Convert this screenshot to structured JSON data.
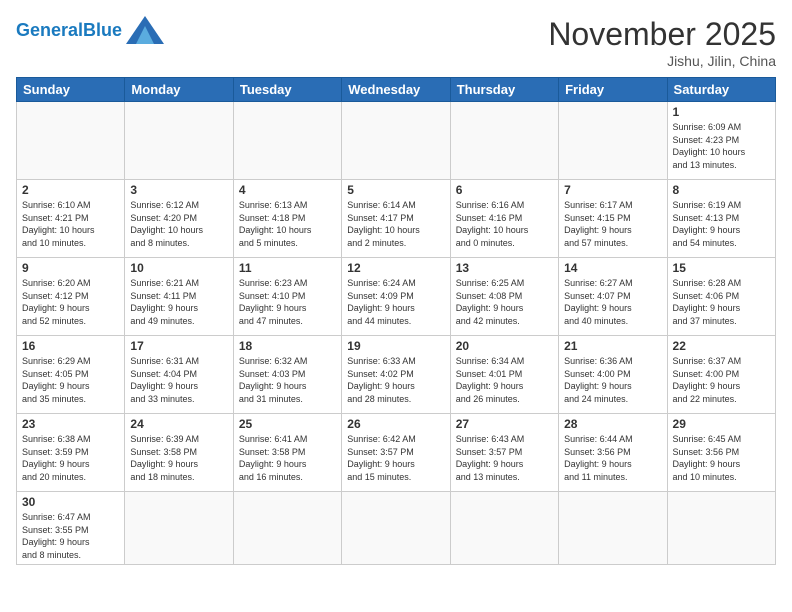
{
  "header": {
    "logo_general": "General",
    "logo_blue": "Blue",
    "month_title": "November 2025",
    "location": "Jishu, Jilin, China"
  },
  "weekdays": [
    "Sunday",
    "Monday",
    "Tuesday",
    "Wednesday",
    "Thursday",
    "Friday",
    "Saturday"
  ],
  "days": [
    {
      "num": "",
      "info": ""
    },
    {
      "num": "",
      "info": ""
    },
    {
      "num": "",
      "info": ""
    },
    {
      "num": "",
      "info": ""
    },
    {
      "num": "",
      "info": ""
    },
    {
      "num": "",
      "info": ""
    },
    {
      "num": "1",
      "info": "Sunrise: 6:09 AM\nSunset: 4:23 PM\nDaylight: 10 hours\nand 13 minutes."
    },
    {
      "num": "2",
      "info": "Sunrise: 6:10 AM\nSunset: 4:21 PM\nDaylight: 10 hours\nand 10 minutes."
    },
    {
      "num": "3",
      "info": "Sunrise: 6:12 AM\nSunset: 4:20 PM\nDaylight: 10 hours\nand 8 minutes."
    },
    {
      "num": "4",
      "info": "Sunrise: 6:13 AM\nSunset: 4:18 PM\nDaylight: 10 hours\nand 5 minutes."
    },
    {
      "num": "5",
      "info": "Sunrise: 6:14 AM\nSunset: 4:17 PM\nDaylight: 10 hours\nand 2 minutes."
    },
    {
      "num": "6",
      "info": "Sunrise: 6:16 AM\nSunset: 4:16 PM\nDaylight: 10 hours\nand 0 minutes."
    },
    {
      "num": "7",
      "info": "Sunrise: 6:17 AM\nSunset: 4:15 PM\nDaylight: 9 hours\nand 57 minutes."
    },
    {
      "num": "8",
      "info": "Sunrise: 6:19 AM\nSunset: 4:13 PM\nDaylight: 9 hours\nand 54 minutes."
    },
    {
      "num": "9",
      "info": "Sunrise: 6:20 AM\nSunset: 4:12 PM\nDaylight: 9 hours\nand 52 minutes."
    },
    {
      "num": "10",
      "info": "Sunrise: 6:21 AM\nSunset: 4:11 PM\nDaylight: 9 hours\nand 49 minutes."
    },
    {
      "num": "11",
      "info": "Sunrise: 6:23 AM\nSunset: 4:10 PM\nDaylight: 9 hours\nand 47 minutes."
    },
    {
      "num": "12",
      "info": "Sunrise: 6:24 AM\nSunset: 4:09 PM\nDaylight: 9 hours\nand 44 minutes."
    },
    {
      "num": "13",
      "info": "Sunrise: 6:25 AM\nSunset: 4:08 PM\nDaylight: 9 hours\nand 42 minutes."
    },
    {
      "num": "14",
      "info": "Sunrise: 6:27 AM\nSunset: 4:07 PM\nDaylight: 9 hours\nand 40 minutes."
    },
    {
      "num": "15",
      "info": "Sunrise: 6:28 AM\nSunset: 4:06 PM\nDaylight: 9 hours\nand 37 minutes."
    },
    {
      "num": "16",
      "info": "Sunrise: 6:29 AM\nSunset: 4:05 PM\nDaylight: 9 hours\nand 35 minutes."
    },
    {
      "num": "17",
      "info": "Sunrise: 6:31 AM\nSunset: 4:04 PM\nDaylight: 9 hours\nand 33 minutes."
    },
    {
      "num": "18",
      "info": "Sunrise: 6:32 AM\nSunset: 4:03 PM\nDaylight: 9 hours\nand 31 minutes."
    },
    {
      "num": "19",
      "info": "Sunrise: 6:33 AM\nSunset: 4:02 PM\nDaylight: 9 hours\nand 28 minutes."
    },
    {
      "num": "20",
      "info": "Sunrise: 6:34 AM\nSunset: 4:01 PM\nDaylight: 9 hours\nand 26 minutes."
    },
    {
      "num": "21",
      "info": "Sunrise: 6:36 AM\nSunset: 4:00 PM\nDaylight: 9 hours\nand 24 minutes."
    },
    {
      "num": "22",
      "info": "Sunrise: 6:37 AM\nSunset: 4:00 PM\nDaylight: 9 hours\nand 22 minutes."
    },
    {
      "num": "23",
      "info": "Sunrise: 6:38 AM\nSunset: 3:59 PM\nDaylight: 9 hours\nand 20 minutes."
    },
    {
      "num": "24",
      "info": "Sunrise: 6:39 AM\nSunset: 3:58 PM\nDaylight: 9 hours\nand 18 minutes."
    },
    {
      "num": "25",
      "info": "Sunrise: 6:41 AM\nSunset: 3:58 PM\nDaylight: 9 hours\nand 16 minutes."
    },
    {
      "num": "26",
      "info": "Sunrise: 6:42 AM\nSunset: 3:57 PM\nDaylight: 9 hours\nand 15 minutes."
    },
    {
      "num": "27",
      "info": "Sunrise: 6:43 AM\nSunset: 3:57 PM\nDaylight: 9 hours\nand 13 minutes."
    },
    {
      "num": "28",
      "info": "Sunrise: 6:44 AM\nSunset: 3:56 PM\nDaylight: 9 hours\nand 11 minutes."
    },
    {
      "num": "29",
      "info": "Sunrise: 6:45 AM\nSunset: 3:56 PM\nDaylight: 9 hours\nand 10 minutes."
    },
    {
      "num": "30",
      "info": "Sunrise: 6:47 AM\nSunset: 3:55 PM\nDaylight: 9 hours\nand 8 minutes."
    },
    {
      "num": "",
      "info": ""
    },
    {
      "num": "",
      "info": ""
    },
    {
      "num": "",
      "info": ""
    },
    {
      "num": "",
      "info": ""
    },
    {
      "num": "",
      "info": ""
    },
    {
      "num": "",
      "info": ""
    }
  ]
}
